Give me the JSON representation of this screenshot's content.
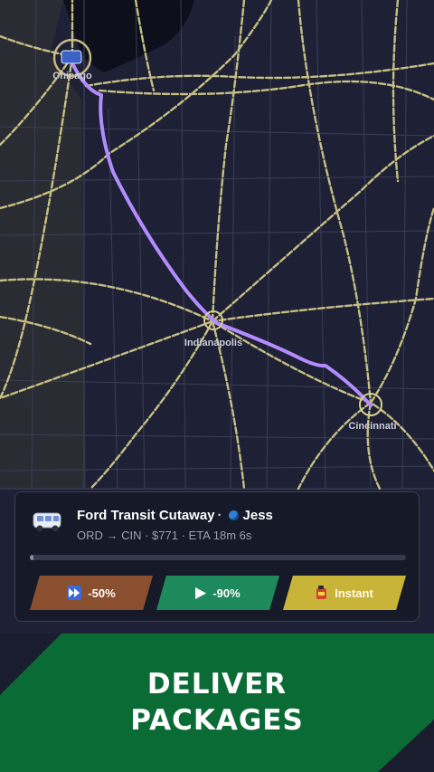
{
  "map": {
    "cities": [
      {
        "name": "Chicago"
      },
      {
        "name": "Indianapolis"
      },
      {
        "name": "Cincinnati"
      }
    ],
    "route_color": "#b38cff",
    "road_color": "#d8cf8a"
  },
  "delivery": {
    "vehicle": "Ford Transit Cutaway",
    "separator": "·",
    "driver": "Jess",
    "details": "ORD → CIN · $771 · ETA 18m 6s",
    "progress": 0.01
  },
  "actions": {
    "speed_label": "-50%",
    "play_label": "-90%",
    "instant_label": "Instant"
  },
  "banner": {
    "line1": "DELIVER",
    "line2": "PACKAGES",
    "color": "#0b6b35"
  }
}
